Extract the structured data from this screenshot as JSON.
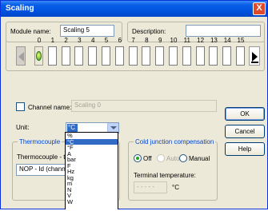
{
  "window": {
    "title": "Scaling",
    "close_glyph": "X"
  },
  "module": {
    "name_label": "Module name:",
    "name_value": "Scaling 5",
    "description_label": "Description:",
    "description_value": ""
  },
  "channels": {
    "numbers": [
      "0",
      "1",
      "2",
      "3",
      "4",
      "5",
      "6",
      "7",
      "8",
      "9",
      "10",
      "11",
      "12",
      "13",
      "14",
      "15"
    ],
    "selected": 0
  },
  "channel_name": {
    "label": "Channel name:",
    "value": "Scaling 0",
    "checked": false
  },
  "unit": {
    "label": "Unit:",
    "selected": "°C",
    "options": [
      "%",
      "°C",
      "°F",
      "A",
      "bar",
      "F",
      "Hz",
      "kg",
      "m",
      "N",
      "V",
      "W"
    ]
  },
  "thermocouple": {
    "group_label": "Thermocouple",
    "types_label": "Thermocouple - types:",
    "type_value": "NOP - Id (channel)"
  },
  "cold_junction": {
    "group_label": "Cold junction compensation",
    "options": [
      "Off",
      "Auto",
      "Manual"
    ],
    "selected": "Off",
    "terminal_label": "Terminal temperature:",
    "terminal_value": "- - - - -",
    "terminal_unit": "°C"
  },
  "buttons": {
    "ok": "OK",
    "cancel": "Cancel",
    "help": "Help"
  },
  "colors": {
    "title_bar": "#0053e0",
    "selection": "#316ac5",
    "dialog_bg": "#ece9d8"
  }
}
